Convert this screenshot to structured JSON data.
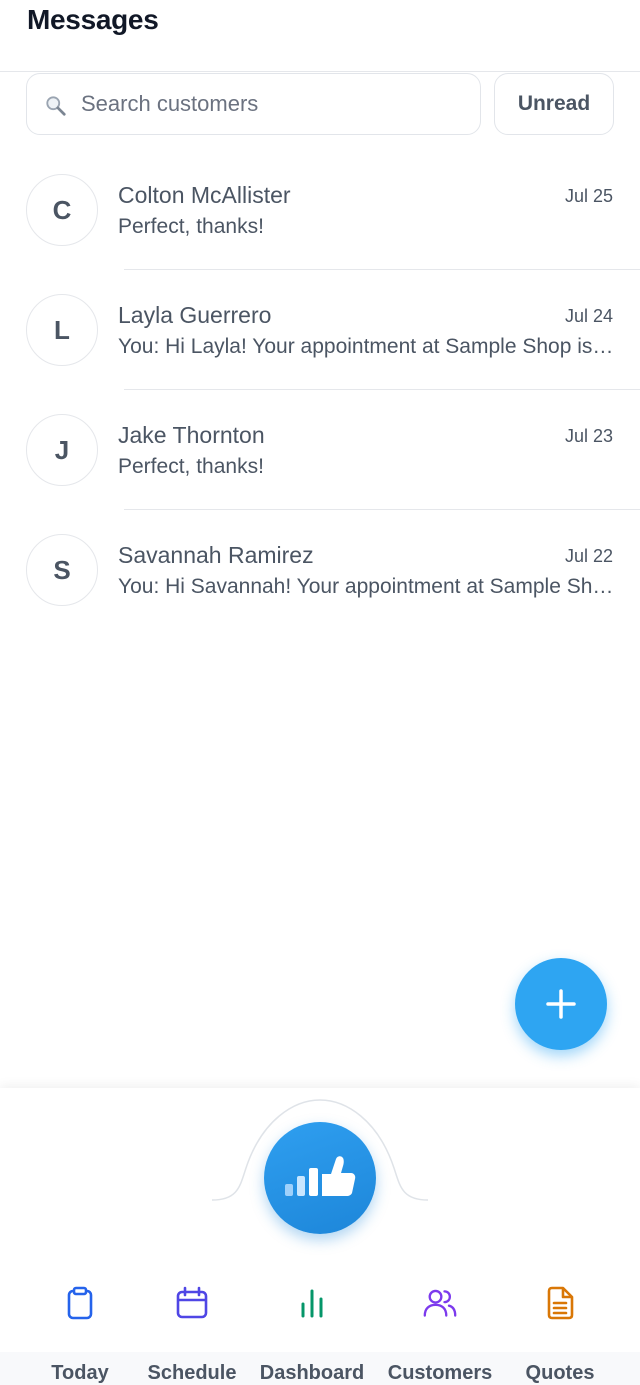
{
  "header": {
    "title": "Messages"
  },
  "search": {
    "placeholder": "Search customers",
    "value": ""
  },
  "filter": {
    "unread_label": "Unread"
  },
  "conversations": [
    {
      "initial": "C",
      "name": "Colton McAllister",
      "date": "Jul 25",
      "preview": "Perfect, thanks!"
    },
    {
      "initial": "L",
      "name": "Layla Guerrero",
      "date": "Jul 24",
      "preview": "You: Hi Layla! Your appointment at Sample Shop is confirmed"
    },
    {
      "initial": "J",
      "name": "Jake Thornton",
      "date": "Jul 23",
      "preview": "Perfect, thanks!"
    },
    {
      "initial": "S",
      "name": "Savannah Ramirez",
      "date": "Jul 22",
      "preview": "You: Hi Savannah! Your appointment at Sample Shop is confirmed"
    }
  ],
  "fab": {
    "icon": "plus-icon"
  },
  "center_action": {
    "icon": "thumbs-up-chart-icon"
  },
  "nav": {
    "tabs": [
      {
        "label": "Today",
        "icon": "clipboard-icon",
        "color": "#2563eb"
      },
      {
        "label": "Schedule",
        "icon": "calendar-icon",
        "color": "#4f46e5"
      },
      {
        "label": "Dashboard",
        "icon": "bar-chart-icon",
        "color": "#059669"
      },
      {
        "label": "Customers",
        "icon": "users-icon",
        "color": "#7c3aed"
      },
      {
        "label": "Quotes",
        "icon": "document-icon",
        "color": "#d97706"
      }
    ]
  },
  "colors": {
    "accent": "#2ea5f2",
    "text_muted": "#4b5563",
    "border": "#e5e7eb"
  }
}
